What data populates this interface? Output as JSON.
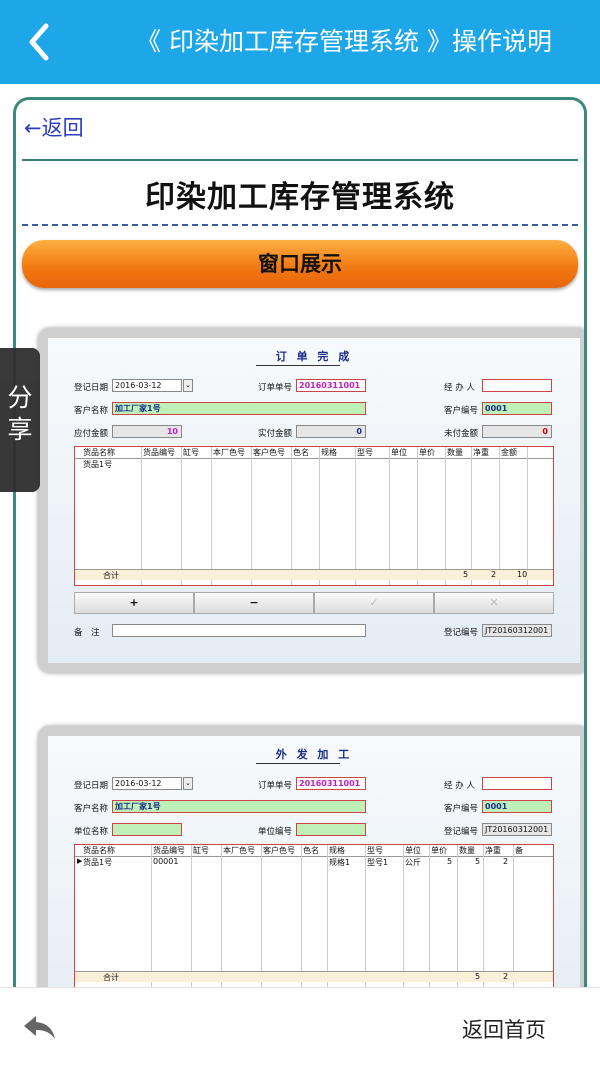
{
  "header": {
    "title": "《 印染加工库存管理系统 》操作说明"
  },
  "nav": {
    "return_link": "←返回",
    "share_label_1": "分",
    "share_label_2": "享"
  },
  "page": {
    "system_title": "印染加工库存管理系统",
    "banner": "窗口展示"
  },
  "bottom": {
    "home_label": "返回首页"
  },
  "shot1": {
    "window_title": "订 单 完 成",
    "reg_date_label": "登记日期",
    "reg_date": "2016-03-12",
    "order_no_label": "订单单号",
    "order_no": "20160311001",
    "handler_label": "经 办 人",
    "customer_label": "客户名称",
    "customer": "加工厂家1号",
    "customer_no_label": "客户编号",
    "customer_no": "0001",
    "due_label": "应付金额",
    "due": "10",
    "paid_label": "实付金额",
    "paid": "0",
    "unpaid_label": "未付金额",
    "unpaid": "0",
    "columns": [
      "货品名称",
      "货品编号",
      "缸号",
      "本厂色号",
      "客户色号",
      "色名",
      "规格",
      "型号",
      "单位",
      "单价",
      "数量",
      "净重",
      "金额"
    ],
    "row1": "货品1号",
    "sum_label": "合计",
    "sum_qty": "5",
    "sum_weight": "2",
    "sum_amount": "10",
    "btn_add": "+",
    "btn_remove": "−",
    "btn_check": "✓",
    "btn_x": "✕",
    "note_label": "备　注",
    "reg_no_label": "登记编号",
    "reg_no": "JT20160312001"
  },
  "shot2": {
    "window_title": "外 发 加 工",
    "reg_date_label": "登记日期",
    "reg_date": "2016-03-12",
    "order_no_label": "订单单号",
    "order_no": "20160311001",
    "handler_label": "经 办 人",
    "customer_label": "客户名称",
    "customer": "加工厂家1号",
    "customer_no_label": "客户编号",
    "customer_no": "0001",
    "unit_name_label": "单位名称",
    "unit_no_label": "单位编号",
    "reg_no_label": "登记编号",
    "reg_no": "JT20160312001",
    "columns": [
      "货品名称",
      "货品编号",
      "缸号",
      "本厂色号",
      "客户色号",
      "色名",
      "规格",
      "型号",
      "单位",
      "单价",
      "数量",
      "净重",
      "备"
    ],
    "row1": [
      "货品1号",
      "00001",
      "",
      "",
      "",
      "",
      "规格1",
      "型号1",
      "公斤",
      "5",
      "5",
      "2"
    ],
    "sum_label": "合计",
    "sum_qty": "5",
    "sum_weight": "2"
  }
}
